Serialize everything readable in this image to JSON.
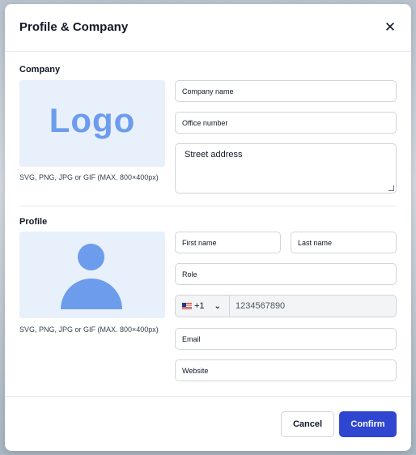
{
  "modal": {
    "title": "Profile & Company",
    "close_icon": "close-icon"
  },
  "company": {
    "section_label": "Company",
    "logo_text": "Logo",
    "upload_hint": "SVG, PNG, JPG or GIF (MAX. 800×400px)",
    "fields": {
      "company_name": {
        "placeholder": "Company name",
        "value": ""
      },
      "office_number": {
        "placeholder": "Office number",
        "value": ""
      },
      "street_address": {
        "placeholder": "Street address",
        "value": ""
      }
    }
  },
  "profile": {
    "section_label": "Profile",
    "avatar_icon": "avatar-placeholder-icon",
    "upload_hint": "SVG, PNG, JPG or GIF (MAX. 800×400px)",
    "fields": {
      "first_name": {
        "placeholder": "First name",
        "value": ""
      },
      "last_name": {
        "placeholder": "Last name",
        "value": ""
      },
      "role": {
        "placeholder": "Role",
        "value": ""
      },
      "phone": {
        "country_flag_icon": "us-flag-icon",
        "country_code": "+1",
        "placeholder": "1234567890",
        "value": ""
      },
      "email": {
        "placeholder": "Email",
        "value": ""
      },
      "website": {
        "placeholder": "Website",
        "value": ""
      }
    }
  },
  "footer": {
    "cancel_label": "Cancel",
    "confirm_label": "Confirm"
  },
  "colors": {
    "primary": "#2f46d0",
    "placeholder_blue": "#6d9ced",
    "placeholder_bg": "#e8f0fb"
  }
}
